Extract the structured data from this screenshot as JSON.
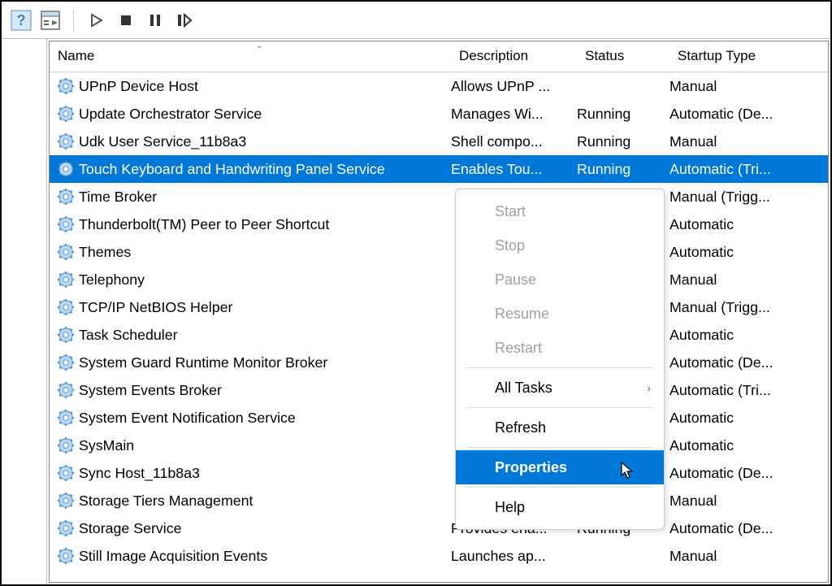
{
  "headers": {
    "name": "Name",
    "description": "Description",
    "status": "Status",
    "startup": "Startup Type"
  },
  "services": [
    {
      "name": "UPnP Device Host",
      "description": "Allows UPnP ...",
      "status": "",
      "startup": "Manual"
    },
    {
      "name": "Update Orchestrator Service",
      "description": "Manages Wi...",
      "status": "Running",
      "startup": "Automatic (De..."
    },
    {
      "name": "Udk User Service_11b8a3",
      "description": "Shell compo...",
      "status": "Running",
      "startup": "Manual"
    },
    {
      "name": "Touch Keyboard and Handwriting Panel Service",
      "description": "Enables Tou...",
      "status": "Running",
      "startup": "Automatic (Tri...",
      "selected": true
    },
    {
      "name": "Time Broker",
      "description": "",
      "status": "",
      "startup": "Manual (Trigg..."
    },
    {
      "name": "Thunderbolt(TM) Peer to Peer Shortcut",
      "description": "",
      "status": "",
      "startup": "Automatic"
    },
    {
      "name": "Themes",
      "description": "",
      "status": "",
      "startup": "Automatic"
    },
    {
      "name": "Telephony",
      "description": "",
      "status": "",
      "startup": "Manual"
    },
    {
      "name": "TCP/IP NetBIOS Helper",
      "description": "",
      "status": "",
      "startup": "Manual (Trigg..."
    },
    {
      "name": "Task Scheduler",
      "description": "",
      "status": "",
      "startup": "Automatic"
    },
    {
      "name": "System Guard Runtime Monitor Broker",
      "description": "",
      "status": "",
      "startup": "Automatic (De..."
    },
    {
      "name": "System Events Broker",
      "description": "",
      "status": "",
      "startup": "Automatic (Tri..."
    },
    {
      "name": "System Event Notification Service",
      "description": "",
      "status": "",
      "startup": "Automatic"
    },
    {
      "name": "SysMain",
      "description": "",
      "status": "",
      "startup": "Automatic"
    },
    {
      "name": "Sync Host_11b8a3",
      "description": "",
      "status": "",
      "startup": "Automatic (De..."
    },
    {
      "name": "Storage Tiers Management",
      "description": "",
      "status": "",
      "startup": "Manual"
    },
    {
      "name": "Storage Service",
      "description": "Provides ena...",
      "status": "Running",
      "startup": "Automatic (De..."
    },
    {
      "name": "Still Image Acquisition Events",
      "description": "Launches ap...",
      "status": "",
      "startup": "Manual"
    }
  ],
  "context_menu": {
    "start": "Start",
    "stop": "Stop",
    "pause": "Pause",
    "resume": "Resume",
    "restart": "Restart",
    "all_tasks": "All Tasks",
    "refresh": "Refresh",
    "properties": "Properties",
    "help": "Help"
  }
}
